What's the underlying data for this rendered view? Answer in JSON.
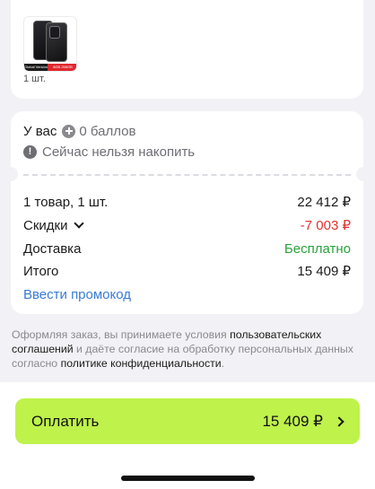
{
  "product": {
    "quantity": "1 шт.",
    "thumb_badge_left": "Global Version",
    "thumb_badge_right": "8GB 256GB"
  },
  "bonus": {
    "you_have_label": "У вас",
    "points": "0 баллов",
    "cannot_accumulate": "Сейчас нельзя накопить"
  },
  "summary": {
    "items_label": "1 товар, 1 шт.",
    "items_value": "22 412 ₽",
    "discounts_label": "Скидки",
    "discounts_value": "-7 003 ₽",
    "delivery_label": "Доставка",
    "delivery_value": "Бесплатно",
    "total_label": "Итого",
    "total_value": "15 409 ₽",
    "promo_link": "Ввести промокод"
  },
  "legal": {
    "part1": "Оформляя заказ, вы принимаете условия ",
    "link1": "пользовательских соглашений",
    "part2": " и даёте согласие на обработку персональных данных согласно ",
    "link2": "политике конфиденциальности",
    "part3": "."
  },
  "pay": {
    "label": "Оплатить",
    "amount": "15 409 ₽"
  },
  "colors": {
    "accent": "#bff24b",
    "discount": "#e3322f",
    "free_delivery": "#29a33b",
    "link": "#3a7bd5"
  },
  "icons": {
    "points": "plus-circle-icon",
    "info": "info-icon",
    "discounts": "chevron-down-icon",
    "pay": "chevron-right-icon"
  }
}
